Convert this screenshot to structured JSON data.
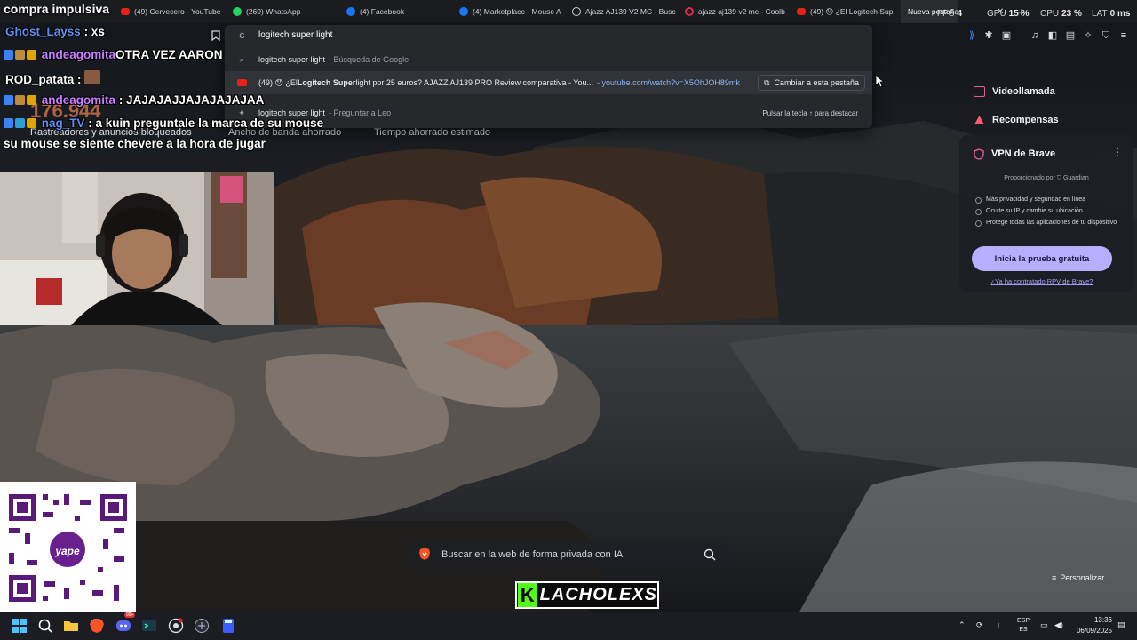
{
  "stream_overlay": {
    "title": "compra impulsiva",
    "counter": "176.944",
    "chat": [
      {
        "user": "Ghost_Layss",
        "message": ": xs"
      },
      {
        "user": "andeagomita",
        "message": "OTRA VEZ AARON"
      },
      {
        "user": "ROD_patata",
        "message": ":"
      },
      {
        "user": "andeagomita",
        "message": ": JAJAJAJJAJAJAJAJAA"
      },
      {
        "user": "nag_TV",
        "message": ": a kuin preguntale la marca de su mouse",
        "cont": "su mouse se siente chevere a la hora de jugar"
      }
    ],
    "channel_logo": "LACHOLEXS"
  },
  "tabs": [
    {
      "label": "(49) Cervecero - YouTube",
      "icon": "youtube-icon"
    },
    {
      "label": "(269) WhatsApp",
      "icon": "whatsapp-icon"
    },
    {
      "label": "(4) Facebook",
      "icon": "facebook-icon"
    },
    {
      "label": "(4) Marketplace - Mouse A",
      "icon": "facebook-icon"
    },
    {
      "label": "Ajazz AJ139 V2 MC - Busc",
      "icon": "globe-icon"
    },
    {
      "label": "ajazz aj139 v2 mc - Coolb",
      "icon": "coolbox-icon"
    },
    {
      "label": "(49) 😯 ¿El Logitech Super",
      "icon": "youtube-icon"
    },
    {
      "label": "Nueva pestaña",
      "icon": ""
    }
  ],
  "system_stats": {
    "fps_label": "FPS",
    "fps": "4",
    "gpu_label": "GPU",
    "gpu": "15 %",
    "cpu_label": "CPU",
    "cpu": "23 %",
    "lat_label": "LAT",
    "lat": "0 ms"
  },
  "omnibox": {
    "input": "logitech super light",
    "suggestions": [
      {
        "main": "logitech super light",
        "secondary": "- Búsqueda de Google"
      },
      {
        "prefix": "(49) 😯 ¿El ",
        "bold": "Logitech Super",
        "rest": "light por 25 euros? AJAZZ AJ139 PRO Review comparativa - You...",
        "url": "- youtube.com/watch?v=X5OhJOH89mk",
        "action": "Cambiar a esta pestaña"
      },
      {
        "main": "logitech super light",
        "secondary": "- Preguntar a Leo",
        "hint": "Pulsar la tecla ↑ para destacar"
      }
    ]
  },
  "new_tab_stats": {
    "trackers": "Rastreadores y anuncios bloqueados",
    "bandwidth": "Ancho de banda ahorrado",
    "time": "Tiempo ahorrado estimado"
  },
  "right_panel": {
    "items": [
      "Videollamada",
      "Recompensas"
    ],
    "vpn": {
      "title": "VPN de Brave",
      "powered_by": "Proporcionado por  ⛉ Guardian",
      "bullets": [
        "Más privacidad y seguridad en línea",
        "Oculte su IP y cambie su ubicación",
        "Protege todas las aplicaciones de tu dispositivo"
      ],
      "cta": "Inicia la prueba gratuita",
      "link": "¿Ya ha contratado RPV de Brave?"
    }
  },
  "search": {
    "placeholder": "Buscar en la web de forma privada con IA"
  },
  "customize": "Personalizar",
  "taskbar": {
    "lang_top": "ESP",
    "lang_bottom": "ES",
    "time": "13:36",
    "date": "06/09/2025",
    "badge": "99+"
  },
  "colors": {
    "accent": "#b9aefe",
    "link": "#a99cff",
    "kick_green": "#53fc18",
    "url_blue": "#8ab4f8"
  }
}
